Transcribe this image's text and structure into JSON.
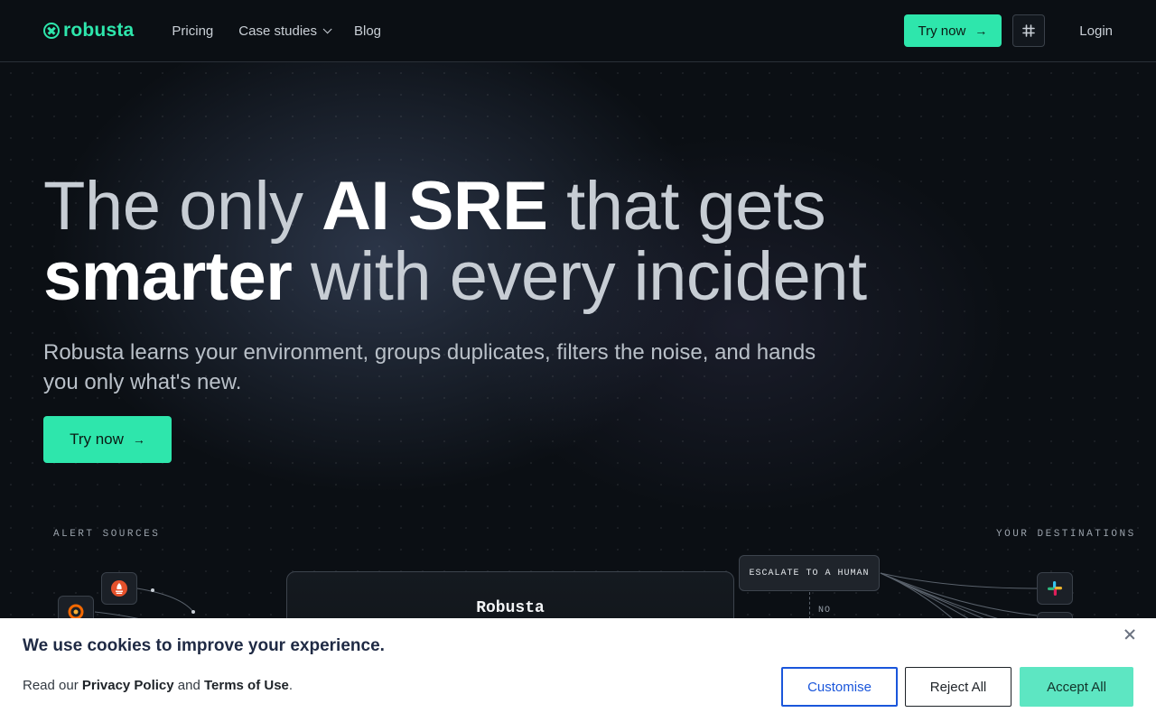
{
  "nav": {
    "logo_text": "robusta",
    "links": [
      "Pricing",
      "Case studies",
      "Blog"
    ],
    "try_label": "Try now",
    "login_label": "Login"
  },
  "hero": {
    "headline_1": "The only ",
    "headline_2": "AI SRE",
    "headline_3": " that gets",
    "headline_4": "smarter",
    "headline_5": " with every incident",
    "subhead": "Robusta learns your environment, groups duplicates, filters the noise, and hands you only what's new.",
    "cta_label": "Try now"
  },
  "diagram": {
    "sources_label": "ALERT SOURCES",
    "destinations_label": "YOUR DESTINATIONS",
    "robusta_label": "Robusta",
    "escalate_label": "ESCALATE TO A HUMAN",
    "no_label": "NO",
    "source_icons": [
      "prometheus-icon",
      "grafana-icon"
    ],
    "destination_icons": [
      "slack-icon"
    ]
  },
  "cookie": {
    "title": "We use cookies to improve your experience.",
    "text_prefix": "Read our ",
    "privacy_link": "Privacy Policy",
    "text_mid": " and ",
    "terms_link": "Terms of Use",
    "text_suffix": ".",
    "customise_label": "Customise",
    "reject_label": "Reject All",
    "accept_label": "Accept All"
  },
  "colors": {
    "accent": "#2ee6ac",
    "background": "#0b0f14",
    "accept_button": "#5de6c2",
    "customise_border": "#1a56db"
  }
}
